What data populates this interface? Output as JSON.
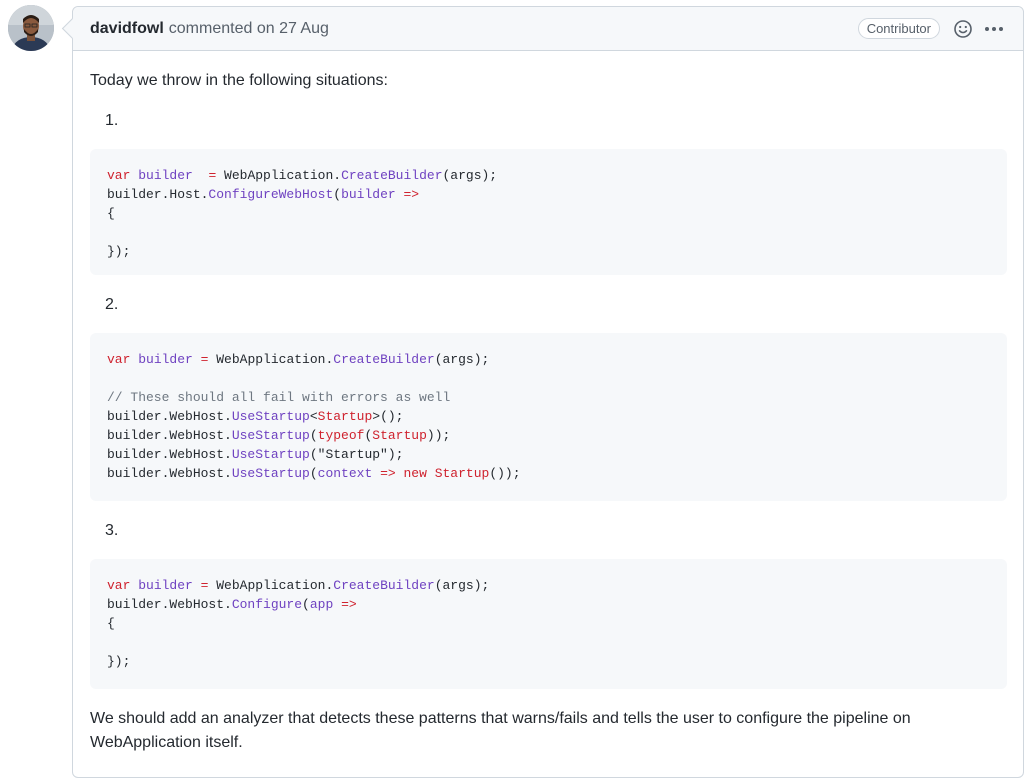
{
  "comment": {
    "author": "davidfowl",
    "meta": "commented on 27 Aug",
    "badge": "Contributor",
    "intro": "Today we throw in the following situations:",
    "items": [
      {
        "number": "1."
      },
      {
        "number": "2."
      },
      {
        "number": "3."
      }
    ],
    "outro": "We should add an analyzer that detects these patterns that warns/fails and tells the user to configure the pipeline on WebApplication itself."
  },
  "code_blocks": [
    [
      [
        [
          "kw",
          "var "
        ],
        [
          "id",
          "builder"
        ],
        [
          "",
          "  "
        ],
        [
          "kw",
          "="
        ],
        [
          "",
          " WebApplication."
        ],
        [
          "id",
          "CreateBuilder"
        ],
        [
          "",
          "(args);"
        ]
      ],
      [
        [
          "",
          "builder.Host."
        ],
        [
          "id",
          "ConfigureWebHost"
        ],
        [
          "",
          "("
        ],
        [
          "id",
          "builder"
        ],
        [
          "kw",
          " =>"
        ]
      ],
      [
        [
          "",
          "{"
        ]
      ],
      [
        [
          "",
          ""
        ]
      ],
      [
        [
          "",
          "});"
        ]
      ]
    ],
    [
      [
        [
          "kw",
          "var "
        ],
        [
          "id",
          "builder"
        ],
        [
          "",
          ""
        ],
        [
          "kw",
          " ="
        ],
        [
          "",
          " WebApplication."
        ],
        [
          "id",
          "CreateBuilder"
        ],
        [
          "",
          "(args);"
        ]
      ],
      [
        [
          "",
          ""
        ]
      ],
      [
        [
          "cm",
          "// These should all fail with errors as well"
        ]
      ],
      [
        [
          "",
          "builder.WebHost."
        ],
        [
          "id",
          "UseStartup"
        ],
        [
          "",
          "<"
        ],
        [
          "kw",
          "Startup"
        ],
        [
          "",
          ">();"
        ]
      ],
      [
        [
          "",
          "builder.WebHost."
        ],
        [
          "id",
          "UseStartup"
        ],
        [
          "",
          "("
        ],
        [
          "kw",
          "typeof"
        ],
        [
          "",
          "("
        ],
        [
          "kw",
          "Startup"
        ],
        [
          "",
          "));"
        ]
      ],
      [
        [
          "",
          "builder.WebHost."
        ],
        [
          "id",
          "UseStartup"
        ],
        [
          "",
          "(\"Startup\");"
        ]
      ],
      [
        [
          "",
          "builder.WebHost."
        ],
        [
          "id",
          "UseStartup"
        ],
        [
          "",
          "("
        ],
        [
          "id",
          "context"
        ],
        [
          "kw",
          " =>"
        ],
        [
          "",
          " "
        ],
        [
          "kw",
          "new"
        ],
        [
          "",
          " "
        ],
        [
          "kw",
          "Startup"
        ],
        [
          "",
          "());"
        ]
      ]
    ],
    [
      [
        [
          "kw",
          "var "
        ],
        [
          "id",
          "builder"
        ],
        [
          "",
          ""
        ],
        [
          "kw",
          " ="
        ],
        [
          "",
          " WebApplication."
        ],
        [
          "id",
          "CreateBuilder"
        ],
        [
          "",
          "(args);"
        ]
      ],
      [
        [
          "",
          "builder.WebHost."
        ],
        [
          "id",
          "Configure"
        ],
        [
          "",
          "("
        ],
        [
          "id",
          "app"
        ],
        [
          "kw",
          " =>"
        ]
      ],
      [
        [
          "",
          "{"
        ]
      ],
      [
        [
          "",
          ""
        ]
      ],
      [
        [
          "",
          "});"
        ]
      ]
    ]
  ]
}
